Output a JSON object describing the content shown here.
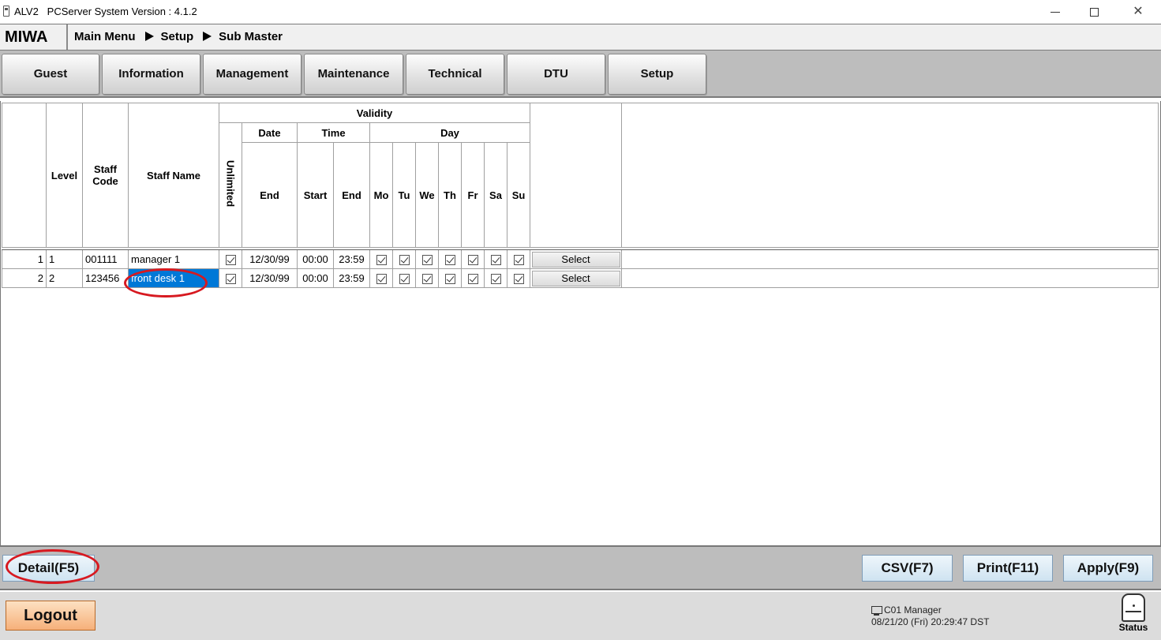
{
  "window": {
    "title": "ALV2   PCServer System Version : 4.1.2",
    "minimize_glyph": "",
    "maximize_glyph": "",
    "close_glyph": "✕"
  },
  "header": {
    "brand": "MIWA",
    "breadcrumb": [
      "Main Menu",
      "Setup",
      "Sub Master"
    ]
  },
  "tabs": [
    {
      "label": "Guest"
    },
    {
      "label": "Information"
    },
    {
      "label": "Management"
    },
    {
      "label": "Maintenance"
    },
    {
      "label": "Technical"
    },
    {
      "label": "DTU"
    },
    {
      "label": "Setup"
    }
  ],
  "grid": {
    "columns": {
      "level": "Level",
      "staff_code": "Staff Code",
      "staff_name": "Staff Name",
      "validity": "Validity",
      "unlimited": "Unlimited",
      "date": "Date",
      "time": "Time",
      "day": "Day",
      "date_end": "End",
      "time_start": "Start",
      "time_end": "End",
      "days": [
        "Mo",
        "Tu",
        "We",
        "Th",
        "Fr",
        "Sa",
        "Su"
      ]
    },
    "rows": [
      {
        "no": "1",
        "level": "1",
        "staff_code": "001111",
        "staff_name": "manager 1",
        "unlimited": true,
        "date_end": "12/30/99",
        "time_start": "00:00",
        "time_end": "23:59",
        "days": [
          true,
          true,
          true,
          true,
          true,
          true,
          true
        ],
        "select_label": "Select"
      },
      {
        "no": "2",
        "level": "2",
        "staff_code": "123456",
        "staff_name": "front desk 1",
        "unlimited": true,
        "date_end": "12/30/99",
        "time_start": "00:00",
        "time_end": "23:59",
        "days": [
          true,
          true,
          true,
          true,
          true,
          true,
          true
        ],
        "select_label": "Select",
        "selected_cell": "staff_name"
      }
    ]
  },
  "actions": {
    "detail": "Detail(F5)",
    "csv": "CSV(F7)",
    "print": "Print(F11)",
    "apply": "Apply(F9)"
  },
  "footer": {
    "logout": "Logout",
    "station": "C01 Manager",
    "datetime": "08/21/20 (Fri) 20:29:47 DST",
    "status_label": "Status"
  },
  "colors": {
    "annotation": "#d71920",
    "selection": "#0078d7",
    "logout_button": "#f6b07a",
    "action_button": "#cfe3f1"
  },
  "icons": {
    "app": "app-icon",
    "station": "pc-icon",
    "status": "status-icon",
    "checkbox": "checkbox-checked"
  }
}
